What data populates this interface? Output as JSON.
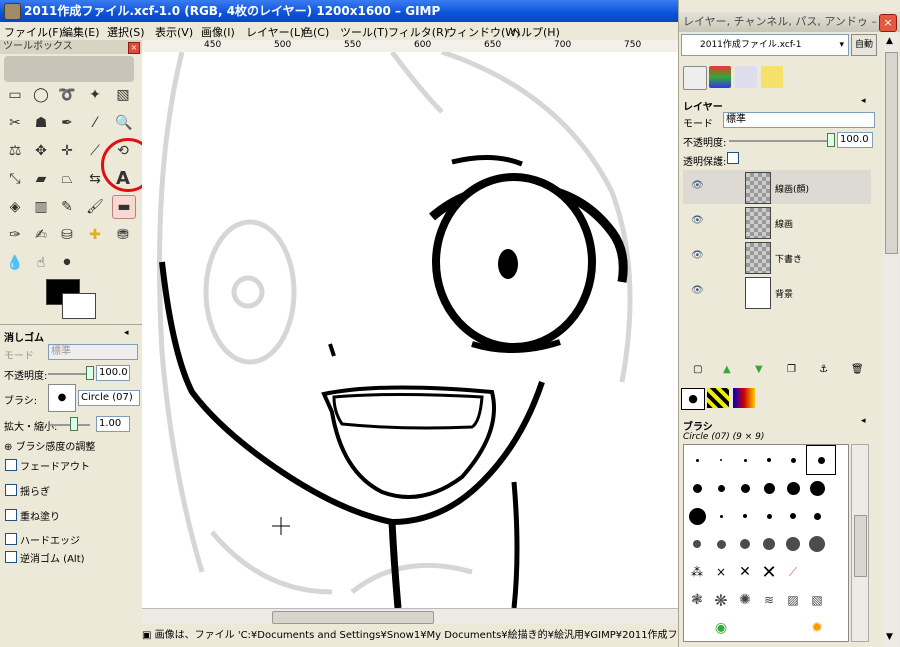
{
  "window": {
    "title": "2011作成ファイル.xcf-1.0 (RGB, 4枚のレイヤー) 1200x1600 – GIMP"
  },
  "menubar": {
    "items": [
      "ファイル(F)",
      "編集(E)",
      "選択(S)",
      "表示(V)",
      "画像(I)",
      "レイヤー(L)",
      "色(C)",
      "ツール(T)",
      "フィルタ(R)",
      "ウィンドウ(W)",
      "ヘルプ(H)"
    ]
  },
  "toolbox": {
    "title": "ツールボックス"
  },
  "ruler": {
    "mark_450": "450",
    "mark_500": "500",
    "mark_550": "550",
    "mark_600": "600",
    "mark_650": "650",
    "mark_700": "700",
    "mark_750": "750"
  },
  "tool_options": {
    "title": "消しゴム",
    "mode_label": "モード",
    "mode_value": "標準",
    "opacity_label": "不透明度:",
    "opacity_value": "100.0",
    "brush_label": "ブラシ:",
    "brush_value": "Circle (07)",
    "scale_label": "拡大・縮小:",
    "scale_value": "1.00",
    "pressure_label": "ブラシ感度の調整",
    "checkboxes": [
      "フェードアウト",
      "揺らぎ",
      "重ね塗り",
      "ハードエッジ",
      "逆消ゴム  (Alt)"
    ]
  },
  "statusbar": {
    "text": "画像は、ファイル 'C:¥Documents and Settings¥Snow1¥My Documents¥絵描き的¥絵汎用¥GIMP¥2011作成ファイル.xcf' に"
  },
  "dock": {
    "title": "レイヤー, チャンネル, パス, アンドゥ –",
    "image_select": "2011作成ファイル.xcf-1",
    "auto_label": "自動",
    "layers": {
      "title": "レイヤー",
      "mode_label": "モード",
      "mode_value": "標準",
      "opacity_label": "不透明度:",
      "opacity_value": "100.0",
      "lock_label": "透明保護:",
      "items": [
        "線画(顔)",
        "線画",
        "下書き",
        "背景"
      ]
    },
    "brushes": {
      "title": "ブラシ",
      "current": "Circle (07) (9 × 9)"
    }
  }
}
